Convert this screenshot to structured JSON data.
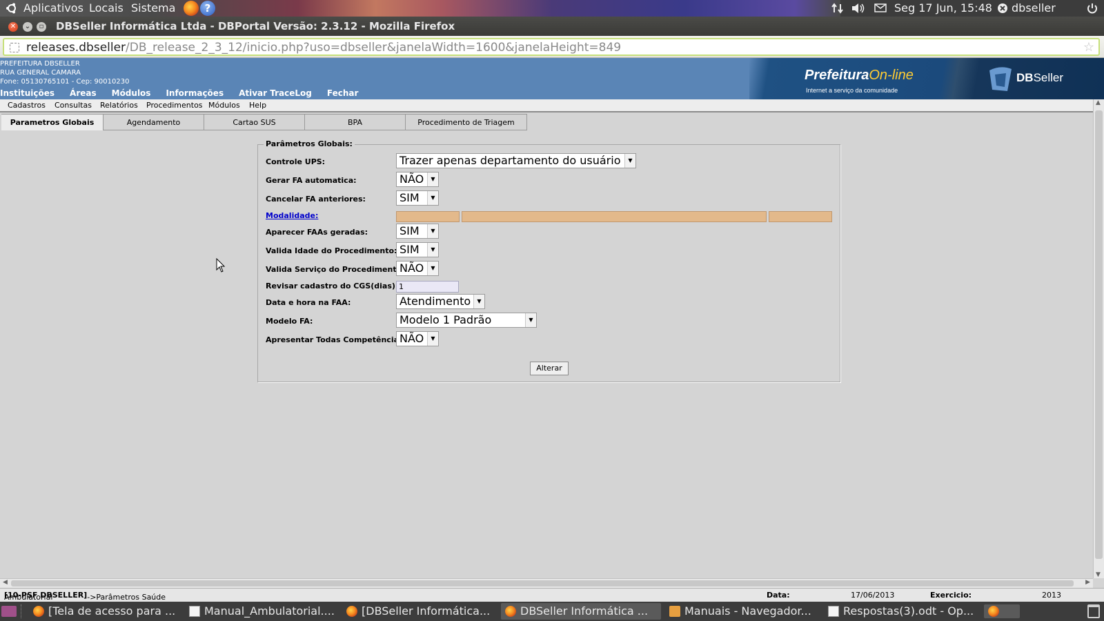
{
  "top_panel": {
    "menu_applications": "Aplicativos",
    "menu_places": "Locais",
    "menu_system": "Sistema",
    "help_glyph": "?",
    "datetime": "Seg 17 Jun, 15:48",
    "username": "dbseller",
    "icons": [
      "ubuntu-logo-icon",
      "firefox-icon",
      "help-icon",
      "network-icon",
      "volume-icon",
      "mail-icon",
      "user-icon",
      "power-icon"
    ]
  },
  "window": {
    "title": "DBSeller Informática Ltda - DBPortal Versão: 2.3.12 - Mozilla Firefox",
    "close_glyph": "✕",
    "min_glyph": "⌄",
    "max_glyph": "▫"
  },
  "urlbar": {
    "host": "releases.dbseller",
    "path": "/DB_release_2_3_12/inicio.php?uso=dbseller&janelaWidth=1600&janelaHeight=849",
    "star_glyph": "☆"
  },
  "header": {
    "institution_name": "PREFEITURA DBSELLER",
    "address": "RUA GENERAL CAMARA",
    "contact": "Fone: 05130765101  -  Cep: 90010230",
    "brand_prefeitura": "Prefeitura",
    "brand_online": "On-line",
    "brand_tagline": "Internet a serviço da comunidade",
    "brand_db": "DB",
    "brand_seller": "Seller",
    "main_menu": [
      "Instituições",
      "Áreas",
      "Módulos",
      "Informações",
      "Ativar TraceLog",
      "Fechar"
    ]
  },
  "sub_menu": [
    "Cadastros",
    "Consultas",
    "Relatórios",
    "Procedimentos",
    "Módulos",
    "Help"
  ],
  "tabs": [
    "Parametros Globais",
    "Agendamento",
    "Cartao SUS",
    "BPA",
    "Procedimento de Triagem"
  ],
  "form": {
    "legend": "Parâmetros Globais:",
    "controle_ups_label": "Controle UPS:",
    "controle_ups_value": "Trazer apenas departamento do usuário",
    "gerar_fa_label": "Gerar FA automatica:",
    "gerar_fa_value": "NÃO",
    "cancelar_fa_label": "Cancelar FA anteriores:",
    "cancelar_fa_value": "SIM",
    "modalidade_label": "Modalidade:",
    "aparecer_faas_label": "Aparecer FAAs geradas:",
    "aparecer_faas_value": "SIM",
    "valida_idade_label": "Valida Idade do Procedimento:",
    "valida_idade_value": "SIM",
    "valida_servico_label": "Valida Serviço do Procedimento:",
    "valida_servico_value": "NÃO",
    "revisar_cgs_label": "Revisar cadastro do CGS(dias):",
    "revisar_cgs_value": "1",
    "data_hora_label": "Data e hora na FAA:",
    "data_hora_value": "Atendimento",
    "modelo_fa_label": "Modelo FA:",
    "modelo_fa_value": "Modelo 1 Padrão",
    "apresentar_label": "Apresentar Todas Competência:",
    "apresentar_value": "NÃO",
    "dropdown_arrow": "▼",
    "submit_label": "Alterar"
  },
  "status_bar": {
    "path_prefix": "Ambulatorial",
    "path_bold": "[10-PSF DBSELLER]",
    "path_suffix": "->Parâmetros Saúde",
    "data_label": "Data:",
    "data_value": "17/06/2013",
    "exercicio_label": "Exercicio:",
    "exercicio_value": "2013"
  },
  "taskbar": {
    "tasks": [
      "[Tela de acesso para ...",
      "Manual_Ambulatorial....",
      "[DBSeller Informática...",
      "DBSeller Informática ...",
      "Manuais - Navegador...",
      "Respostas(3).odt - Op..."
    ],
    "icons": [
      "show-desktop-icon",
      "firefox-icon",
      "document-icon",
      "folder-icon",
      "trash-icon"
    ]
  }
}
